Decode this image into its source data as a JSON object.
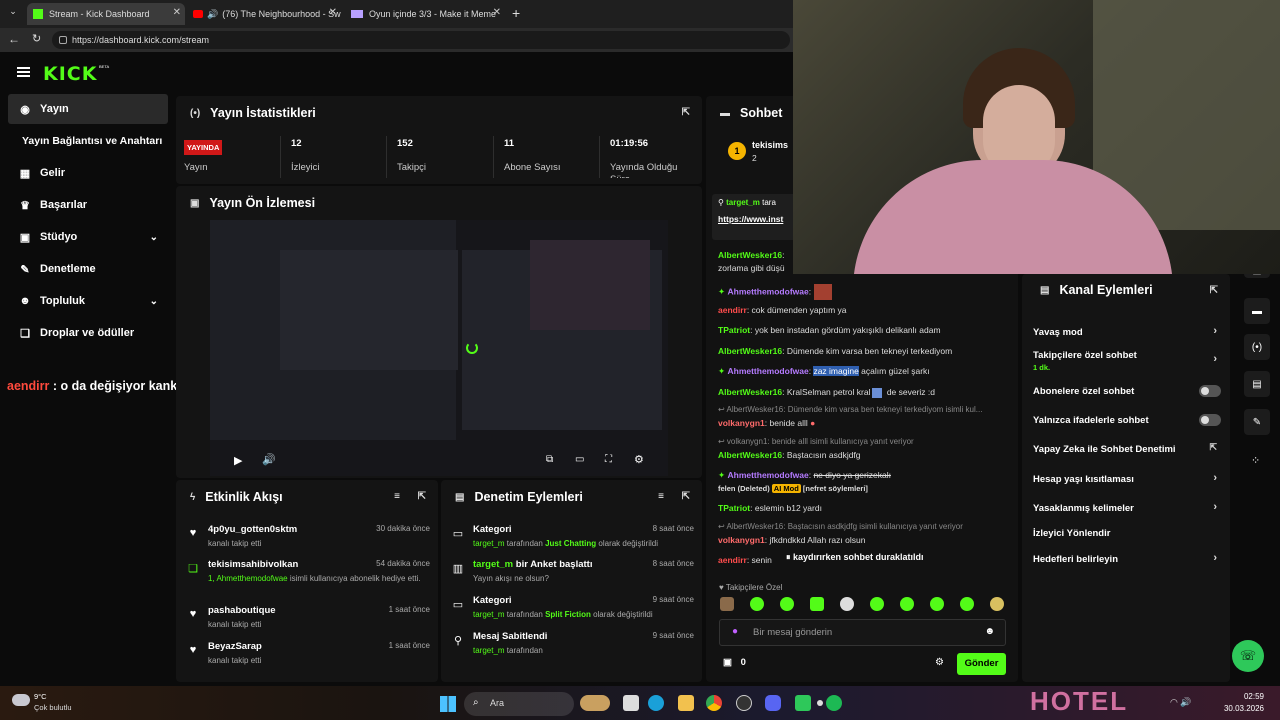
{
  "browser": {
    "tabs": [
      {
        "label": "Stream - Kick Dashboard",
        "active": true
      },
      {
        "label": "(76) The Neighbourhood - Sw",
        "active": false
      },
      {
        "label": "Oyun içinde 3/3 - Make it Meme",
        "active": false
      }
    ],
    "url": "https://dashboard.kick.com/stream"
  },
  "brand": {
    "logo": "KICK",
    "beta": "BETA",
    "accent": "#53fc18"
  },
  "sidebar": {
    "items": [
      {
        "label": "Yayın",
        "icon": "broadcast-icon"
      },
      {
        "label": "Yayın Bağlantısı ve Anahtarı",
        "icon": ""
      },
      {
        "label": "Gelir",
        "icon": "revenue-icon"
      },
      {
        "label": "Başarılar",
        "icon": "trophy-icon"
      },
      {
        "label": "Stüdyo",
        "icon": "studio-icon"
      },
      {
        "label": "Denetleme",
        "icon": "wrench-icon"
      },
      {
        "label": "Topluluk",
        "icon": "community-icon"
      },
      {
        "label": "Droplar ve ödüller",
        "icon": "gift-icon"
      }
    ]
  },
  "stats": {
    "title": "Yayın İstatistikleri",
    "live_badge": "YAYINDA",
    "live_label": "Yayın",
    "items": [
      {
        "value": "12",
        "label": "İzleyici"
      },
      {
        "value": "152",
        "label": "Takipçi"
      },
      {
        "value": "11",
        "label": "Abone Sayısı"
      },
      {
        "value": "01:19:56",
        "label": "Yayında Olduğu Süre"
      }
    ]
  },
  "preview": {
    "title": "Yayın Ön İzlemesi"
  },
  "overlay_chat": {
    "user": "aendirr",
    "text": " : o da değişiyor kanka adamına göre muamele alşsdkfjaşksdfka"
  },
  "activity": {
    "title": "Etkinlik Akışı",
    "items": [
      {
        "title": "4p0yu_gotten0sktm",
        "sub": "kanalı takip etti",
        "time": "30 dakika önce",
        "icon": "heart-icon"
      },
      {
        "title": "tekisimsahibivolkan",
        "sub_green": "1, Ahmetthemodofwae",
        "sub": " isimli kullanıcıya abonelik hediye etti.",
        "time": "54 dakika önce",
        "icon": "gift-icon"
      },
      {
        "title": "pashaboutique",
        "sub": "kanalı takip etti",
        "time": "1 saat önce",
        "icon": "heart-icon"
      },
      {
        "title": "BeyazSarap",
        "sub": "kanalı takip etti",
        "time": "1 saat önce",
        "icon": "heart-icon"
      }
    ]
  },
  "moderation": {
    "title": "Denetim Eylemleri",
    "items": [
      {
        "title": "Kategori",
        "user": "target_m",
        "mid": " tarafından ",
        "green2": "Just Chatting",
        "end": " olarak değiştirildi",
        "time": "8 saat önce"
      },
      {
        "title": "target_m",
        "title_suffix": " bir Anket başlattı",
        "sub": "Yayın akışı ne olsun?",
        "time": "8 saat önce"
      },
      {
        "title": "Kategori",
        "user": "target_m",
        "mid": " tarafından ",
        "green2": "Split Fiction",
        "end": " olarak değiştirildi",
        "time": "9 saat önce"
      },
      {
        "title": "Mesaj Sabitlendi",
        "user": "target_m",
        "mid": " tarafından",
        "green2": "",
        "end": "",
        "time": "9 saat önce"
      }
    ]
  },
  "chat": {
    "title": "Sohbet",
    "top_user": "tekisims",
    "top_count": "2",
    "pinned_user": "target_m",
    "pinned_text": "tara",
    "pinned_link": "https://www.inst",
    "lines": [
      {
        "user": "AlbertWesker16",
        "text": ": ",
        "cont": "zorlama gibi düşü"
      },
      {
        "user": "Ahmetthemodofwae",
        "text": ":",
        "style": "pur"
      },
      {
        "user": "aendirr",
        "text": ": cok dümenden yaptım ya",
        "style": "red"
      },
      {
        "user": "TPatriot",
        "text": ": yok ben instadan gördüm yakışıklı delikanlı adam"
      },
      {
        "user": "AlbertWesker16",
        "text": ": Dümende kim varsa ben tekneyi terkediyom"
      },
      {
        "user": "Ahmetthemodofwae",
        "text": ": ",
        "hl": "zaz imagine",
        "after": " açalım güzel şarkı",
        "style": "pur"
      },
      {
        "user": "AlbertWesker16",
        "text": ": KralSelman petrol kral",
        "after": " de severiz :d"
      },
      {
        "sys": "↩ AlbertWesker16: Dümende kim varsa ben tekneyi terkediyom isimli kul..."
      },
      {
        "user": "volkanygn1",
        "text": ": benide alll"
      },
      {
        "sys": "↩ volkanygn1: benide alll isimli kullanıcıya yanıt veriyor"
      },
      {
        "user": "AlbertWesker16",
        "text": ": Baştacısın asdkjdfg"
      },
      {
        "user": "Ahmetthemodofwae",
        "text": ": ",
        "strike": "ne diyo ya gerizekalı",
        "style": "pur"
      },
      {
        "plain": "felen",
        "deleted": "(Deleted)",
        "aimod": "AI Mod",
        "reason": "[nefret söylemleri]"
      },
      {
        "user": "TPatriot",
        "text": ": eslemin b12 yardı"
      },
      {
        "sys": "↩ AlbertWesker16: Baştacısın asdkjdfg isimli kullanıcıya yanıt veriyor"
      },
      {
        "user": "volkanygn1",
        "text": ": jfkdndkkd Allah razı olsun"
      },
      {
        "user": "aendirr",
        "text": ": senin ",
        "style": "red"
      }
    ],
    "paused": "kaydırırken sohbet duraklatıldı",
    "followers_only": "Takipçilere Özel",
    "input_placeholder": "Bir mesaj gönderin",
    "points": "0",
    "send": "Gönder"
  },
  "channel_actions": {
    "title": "Kanal Eylemleri",
    "items": [
      {
        "label": "Yavaş mod",
        "type": "arrow"
      },
      {
        "label": "Takipçilere özel sohbet",
        "sub": "1 dk.",
        "type": "arrow"
      },
      {
        "label": "Abonelere özel sohbet",
        "type": "toggle"
      },
      {
        "label": "Yalnızca ifadelerle sohbet",
        "type": "toggle"
      },
      {
        "label": "Yapay Zeka ile Sohbet Denetimi",
        "type": "external"
      },
      {
        "label": "Hesap yaşı kısıtlaması",
        "type": "arrow"
      },
      {
        "label": "Yasaklanmış kelimeler",
        "type": "arrow"
      },
      {
        "label": "İzleyici Yönlendir",
        "type": "none"
      },
      {
        "label": "Hedefleri belirleyin",
        "type": "arrow"
      }
    ]
  },
  "taskbar": {
    "weather_temp": "9°C",
    "weather_desc": "Çok bulutlu",
    "search": "Ara",
    "time": "02:59",
    "date": "30.03.2026",
    "hotel_sign": "HOTEL"
  }
}
